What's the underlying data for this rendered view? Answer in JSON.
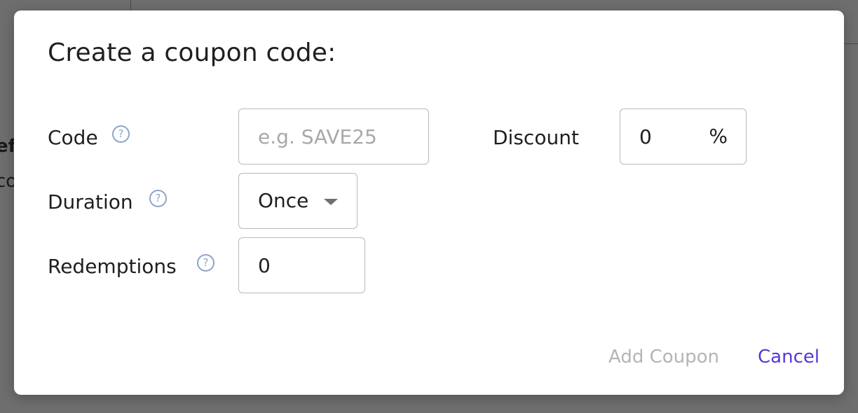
{
  "background": {
    "partial_text_1": "ef",
    "partial_text_2": "co"
  },
  "dialog": {
    "title": "Create a coupon code:",
    "help_glyph": "?",
    "code": {
      "label": "Code",
      "value": "",
      "placeholder": "e.g. SAVE25"
    },
    "discount": {
      "label": "Discount",
      "value": "0",
      "unit": "%"
    },
    "duration": {
      "label": "Duration",
      "selected": "Once"
    },
    "redemptions": {
      "label": "Redemptions",
      "value": "0"
    },
    "buttons": {
      "add": "Add Coupon",
      "cancel": "Cancel"
    }
  },
  "colors": {
    "overlay": "#6e6e6e",
    "accent": "#5b35d5",
    "help_icon": "#8fa6c8",
    "disabled_text": "#b5b5b5"
  }
}
